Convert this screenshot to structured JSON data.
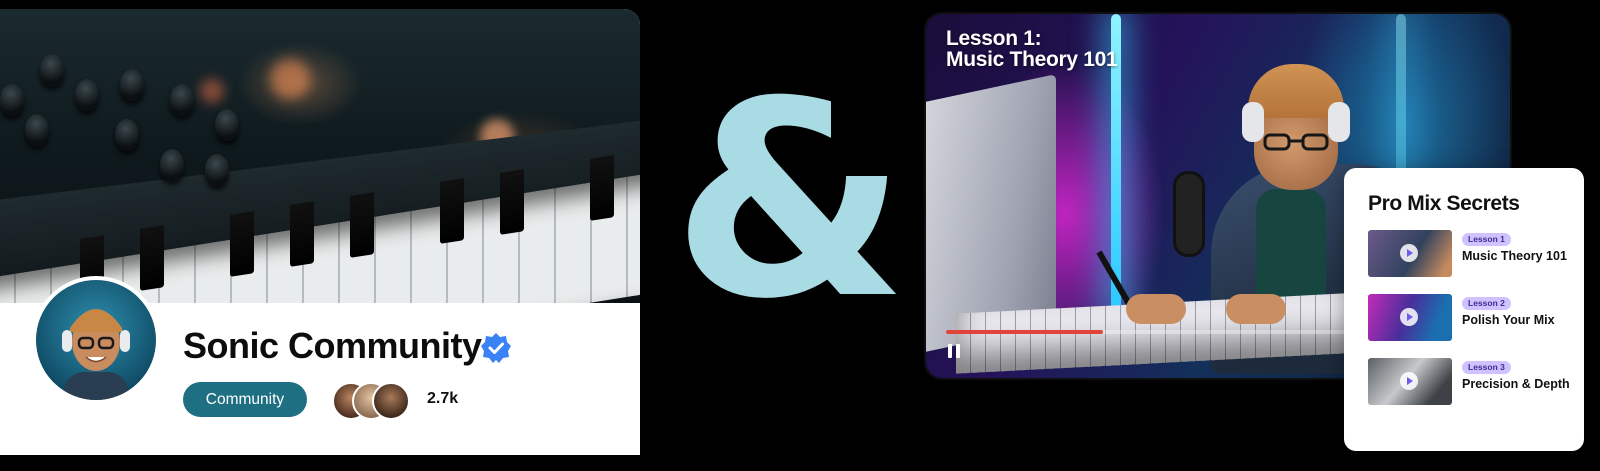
{
  "community": {
    "name": "Sonic Community",
    "tag": "Community",
    "member_count": "2.7k"
  },
  "connector": {
    "symbol": "&"
  },
  "video": {
    "title_line1": "Lesson 1:",
    "title_line2": "Music Theory 101",
    "progress_fraction": 0.28
  },
  "course": {
    "title": "Pro Mix Secrets",
    "lessons": [
      {
        "badge": "Lesson 1",
        "name": "Music Theory 101"
      },
      {
        "badge": "Lesson 2",
        "name": "Polish Your Mix"
      },
      {
        "badge": "Lesson 3",
        "name": "Precision & Depth"
      }
    ]
  },
  "colors": {
    "brand_teal": "#1f6f82",
    "ampersand": "#a8dbe3",
    "verified_blue": "#3b82f6",
    "progress_red": "#e2433a",
    "lesson_badge": "#cfc2ff"
  },
  "icons": [
    "verified-badge-icon",
    "pause-icon",
    "play-icon"
  ]
}
